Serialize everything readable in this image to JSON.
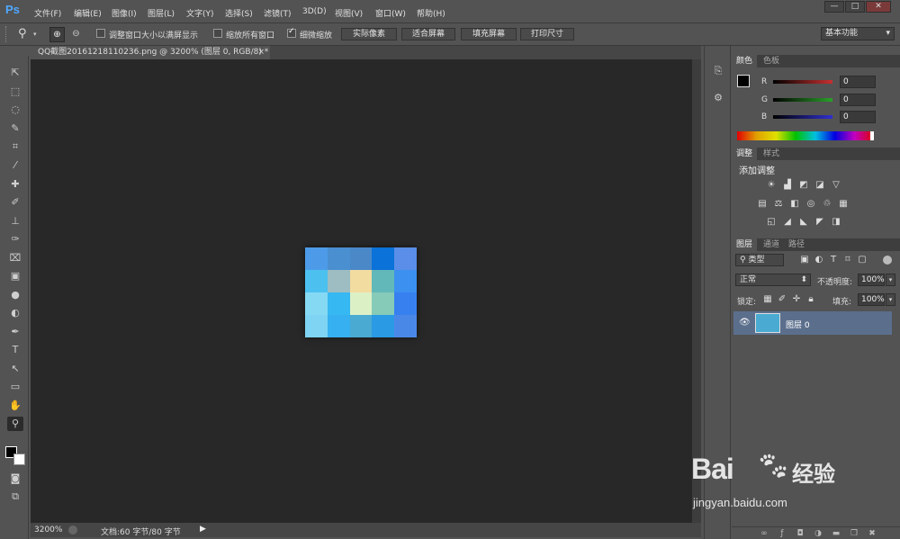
{
  "app": {
    "logo": "Ps"
  },
  "menu": [
    "文件(F)",
    "编辑(E)",
    "图像(I)",
    "图层(L)",
    "文字(Y)",
    "选择(S)",
    "滤镜(T)",
    "3D(D)",
    "视图(V)",
    "窗口(W)",
    "帮助(H)"
  ],
  "window_controls": {
    "minimize": "—",
    "restore": "□",
    "close": "✕"
  },
  "options": {
    "resize_windows": "调整窗口大小以满屏显示",
    "zoom_all": "缩放所有窗口",
    "scrubby_zoom": "细微缩放",
    "btn_actual": "实际像素",
    "btn_fit": "适合屏幕",
    "btn_fill": "填充屏幕",
    "btn_print": "打印尺寸",
    "workspace": "基本功能"
  },
  "document": {
    "tab_title": "QQ截图20161218110236.png @ 3200% (图层 0, RGB/8) *"
  },
  "status": {
    "zoom": "3200%",
    "doc_info": "文档:60 字节/80 字节"
  },
  "canvas_pixels": [
    [
      "#4d9be8",
      "#4a8fd0",
      "#4a88c8",
      "#0a72d8",
      "#5a8ee8"
    ],
    [
      "#4cc1f0",
      "#9ebdc2",
      "#f2dca0",
      "#62b8b8",
      "#3c90f0"
    ],
    [
      "#86d9f2",
      "#36b8f2",
      "#dcf0c6",
      "#86cab8",
      "#3780f0"
    ],
    [
      "#7ed4f2",
      "#36b0f0",
      "#4aaad2",
      "#2a9ae4",
      "#4a88e8"
    ]
  ],
  "color_panel": {
    "tabs": [
      "颜色",
      "色板"
    ],
    "channels": [
      {
        "label": "R",
        "value": "0",
        "color": "#c83030"
      },
      {
        "label": "G",
        "value": "0",
        "color": "#2aa02a"
      },
      {
        "label": "B",
        "value": "0",
        "color": "#3030d0"
      }
    ]
  },
  "adjust_panel": {
    "tabs": [
      "调整",
      "样式"
    ],
    "title": "添加调整"
  },
  "layers_panel": {
    "tabs": [
      "图层",
      "通道",
      "路径"
    ],
    "kind": "类型",
    "blend": "正常",
    "opacity_label": "不透明度:",
    "opacity_value": "100%",
    "lock_label": "锁定:",
    "fill_label": "填充:",
    "fill_value": "100%",
    "layers": [
      {
        "name": "图层 0"
      }
    ]
  },
  "watermark": {
    "brand": "Bai",
    "brand2": "经验",
    "url": "jingyan.baidu.com"
  }
}
